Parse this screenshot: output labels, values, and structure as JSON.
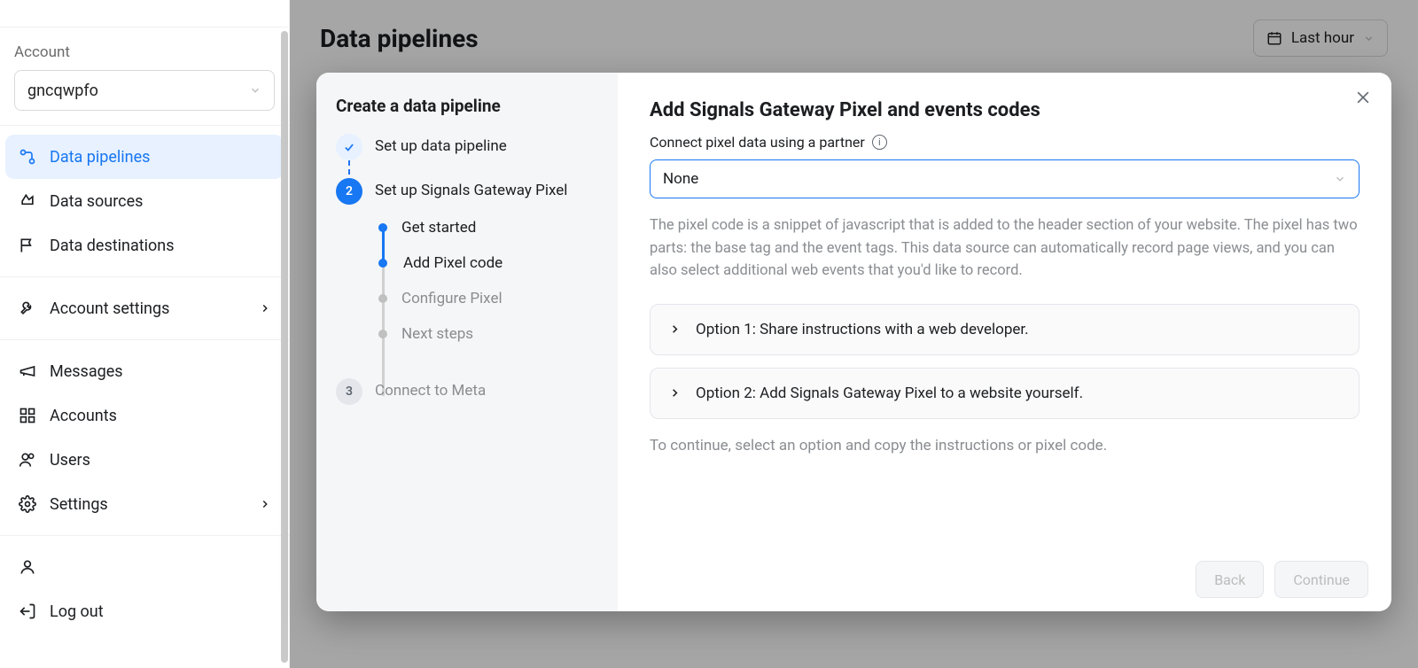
{
  "sidebar": {
    "account_label": "Account",
    "account_value": "gncqwpfo",
    "group1": [
      {
        "label": "Data pipelines"
      },
      {
        "label": "Data sources"
      },
      {
        "label": "Data destinations"
      }
    ],
    "group2": [
      {
        "label": "Account settings"
      }
    ],
    "group3": [
      {
        "label": "Messages"
      },
      {
        "label": "Accounts"
      },
      {
        "label": "Users"
      },
      {
        "label": "Settings"
      }
    ],
    "logout": "Log out"
  },
  "header": {
    "title": "Data pipelines",
    "time_filter": "Last hour"
  },
  "modal": {
    "title": "Create a data pipeline",
    "steps": {
      "s1": "Set up data pipeline",
      "s2": "Set up Signals Gateway Pixel",
      "s2_num": "2",
      "s3": "Connect to Meta",
      "s3_num": "3",
      "sub": {
        "a": "Get started",
        "b": "Add Pixel code",
        "c": "Configure Pixel",
        "d": "Next steps"
      }
    },
    "section_title": "Add Signals Gateway Pixel and events codes",
    "field_label": "Connect pixel data using a partner",
    "select_value": "None",
    "help_text": "The pixel code is a snippet of javascript that is added to the header section of your website. The pixel has two parts: the base tag and the event tags. This data source can automatically record page views, and you can also select additional web events that you'd like to record.",
    "option1": "Option 1: Share instructions with a web developer.",
    "option2": "Option 2: Add Signals Gateway Pixel to a website yourself.",
    "hint": "To continue, select an option and copy the instructions or pixel code.",
    "back": "Back",
    "continue": "Continue"
  }
}
